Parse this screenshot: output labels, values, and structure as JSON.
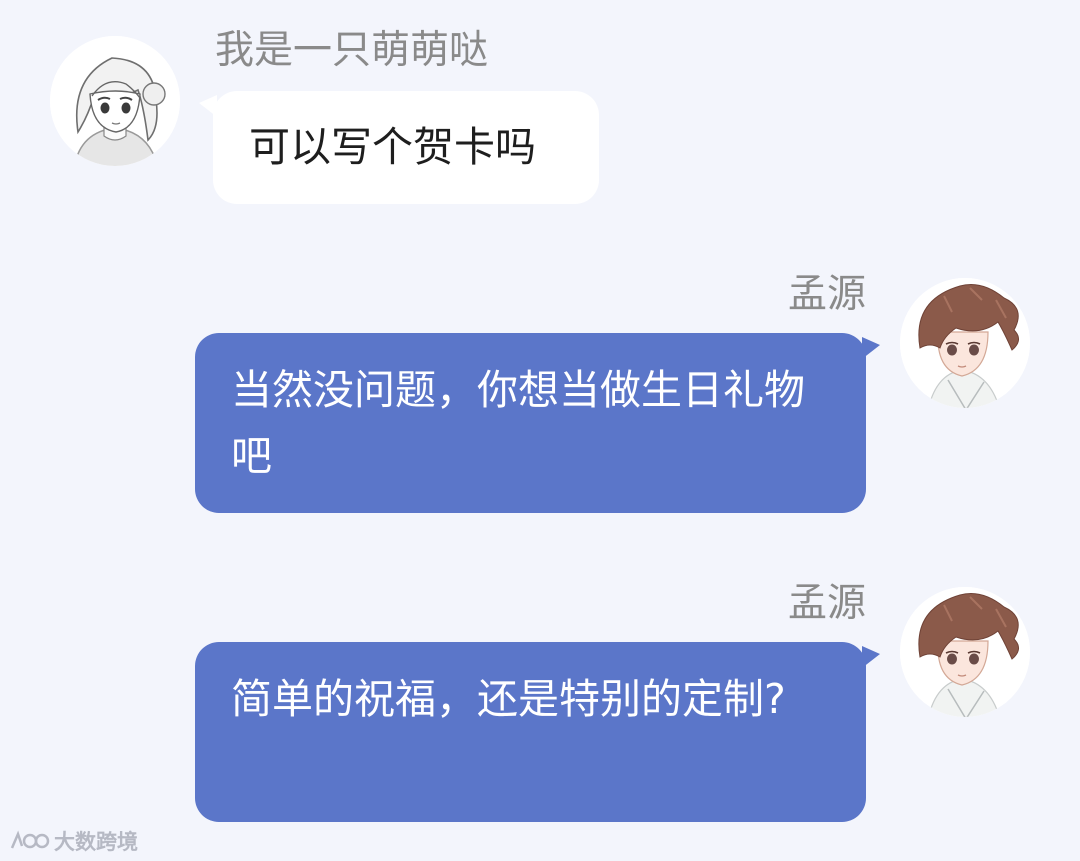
{
  "chat": {
    "messages": [
      {
        "sender": "我是一只萌萌哒",
        "text": "可以写个贺卡吗",
        "direction": "received",
        "avatar": "girl-avatar-icon"
      },
      {
        "sender": "孟源",
        "text": "当然没问题，你想当做生日礼物吧",
        "direction": "sent",
        "avatar": "boy-avatar-icon"
      },
      {
        "sender": "孟源",
        "text": "简单的祝福，还是特别的定制?",
        "direction": "sent",
        "avatar": "boy-avatar-icon"
      }
    ]
  },
  "watermark": {
    "text": "大数跨境",
    "icon": "brand-logo-icon"
  },
  "colors": {
    "background": "#f3f5fc",
    "sent_bubble": "#5b76c9",
    "received_bubble": "#ffffff",
    "sender_name": "#8a8a8a"
  }
}
